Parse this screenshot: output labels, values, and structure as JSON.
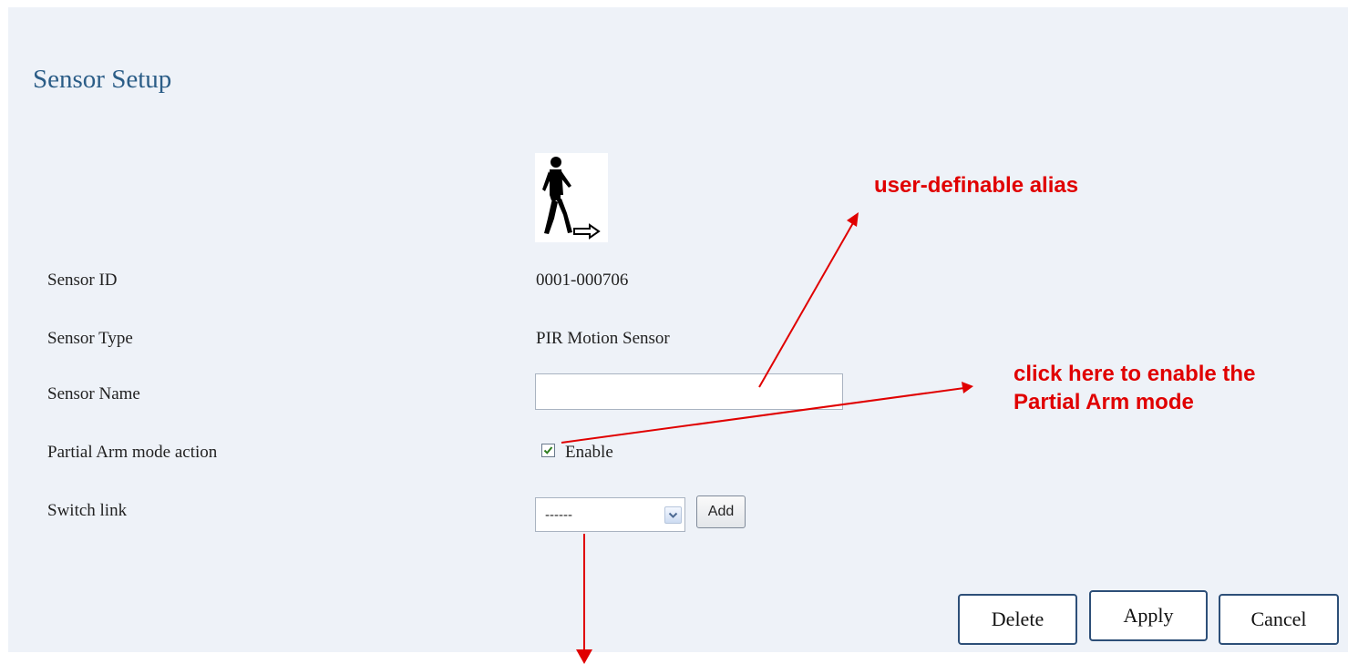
{
  "page": {
    "title": "Sensor Setup"
  },
  "sensor_icon": {
    "icon": "pir-motion-sensor-icon"
  },
  "fields": {
    "sensor_id": {
      "label": "Sensor ID",
      "value": "0001-000706"
    },
    "sensor_type": {
      "label": "Sensor Type",
      "value": "PIR Motion Sensor"
    },
    "sensor_name": {
      "label": "Sensor Name",
      "value": ""
    },
    "partial_arm": {
      "label": "Partial Arm mode action",
      "checkbox_label": "Enable",
      "checked": true
    },
    "switch_link": {
      "label": "Switch link",
      "selected": "------",
      "add_label": "Add"
    }
  },
  "actions": {
    "delete_label": "Delete",
    "apply_label": "Apply",
    "cancel_label": "Cancel"
  },
  "annotations": {
    "alias_note": "user-definable alias",
    "partial_arm_note_line1": "click here to enable the",
    "partial_arm_note_line2": "Partial Arm mode",
    "color": "#e00000"
  }
}
